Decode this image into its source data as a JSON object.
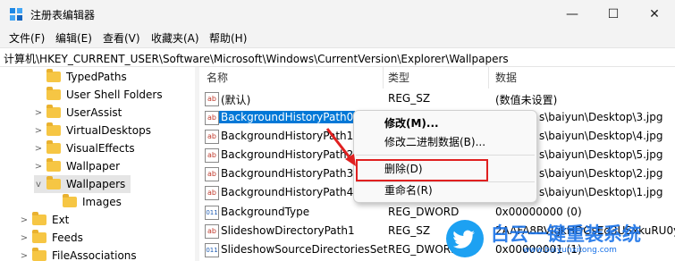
{
  "window": {
    "title": "注册表编辑器",
    "minimize": "—",
    "maximize": "☐",
    "close": "✕"
  },
  "menu": [
    "文件(F)",
    "编辑(E)",
    "查看(V)",
    "收藏夹(A)",
    "帮助(H)"
  ],
  "address": "计算机\\HKEY_CURRENT_USER\\Software\\Microsoft\\Windows\\CurrentVersion\\Explorer\\Wallpapers",
  "tree": [
    {
      "label": "TypedPaths",
      "expand": ""
    },
    {
      "label": "User Shell Folders",
      "expand": ""
    },
    {
      "label": "UserAssist",
      "expand": ">"
    },
    {
      "label": "VirtualDesktops",
      "expand": ">"
    },
    {
      "label": "VisualEffects",
      "expand": ">"
    },
    {
      "label": "Wallpaper",
      "expand": ">"
    },
    {
      "label": "Wallpapers",
      "expand": "v"
    },
    {
      "label": "Images",
      "expand": ""
    },
    {
      "label": "Ext",
      "expand": ">"
    },
    {
      "label": "Feeds",
      "expand": ">"
    },
    {
      "label": "FileAssociations",
      "expand": ">"
    }
  ],
  "columns": {
    "name": "名称",
    "type": "类型",
    "data": "数据"
  },
  "values": [
    {
      "name": "(默认)",
      "type": "REG_SZ",
      "data": "(数值未设置)",
      "icon": "ab"
    },
    {
      "name": "BackgroundHistoryPath0",
      "type": "",
      "data": "s\\baiyun\\Desktop\\3.jpg",
      "icon": "ab"
    },
    {
      "name": "BackgroundHistoryPath1",
      "type": "",
      "data": "s\\baiyun\\Desktop\\4.jpg",
      "icon": "ab"
    },
    {
      "name": "BackgroundHistoryPath2",
      "type": "",
      "data": "s\\baiyun\\Desktop\\5.jpg",
      "icon": "ab"
    },
    {
      "name": "BackgroundHistoryPath3",
      "type": "",
      "data": "s\\baiyun\\Desktop\\2.jpg",
      "icon": "ab"
    },
    {
      "name": "BackgroundHistoryPath4",
      "type": "",
      "data": "s\\baiyun\\Desktop\\1.jpg",
      "icon": "ab"
    },
    {
      "name": "BackgroundType",
      "type": "REG_DWORD",
      "data": "0x00000000 (0)",
      "icon": "bin"
    },
    {
      "name": "SlideshowDirectoryPath1",
      "type": "REG_SZ",
      "data": "2AAFA8BVlgkHDGsEd3USxkuRU0yl...",
      "icon": "ab"
    },
    {
      "name": "SlideshowSourceDirectoriesSet",
      "type": "REG_DWORD",
      "data": "0x00000001 (1)",
      "icon": "bin"
    }
  ],
  "context_menu": {
    "modify": "修改(M)...",
    "modify_binary": "修改二进制数据(B)...",
    "delete": "删除(D)",
    "rename": "重命名(R)"
  },
  "watermark": {
    "line1": "白云一键重装系统",
    "line2": "www.baiyunxitong.com"
  },
  "colors": {
    "selection": "#0078d7",
    "highlight_box": "#e02020",
    "folder": "#f6c644"
  }
}
